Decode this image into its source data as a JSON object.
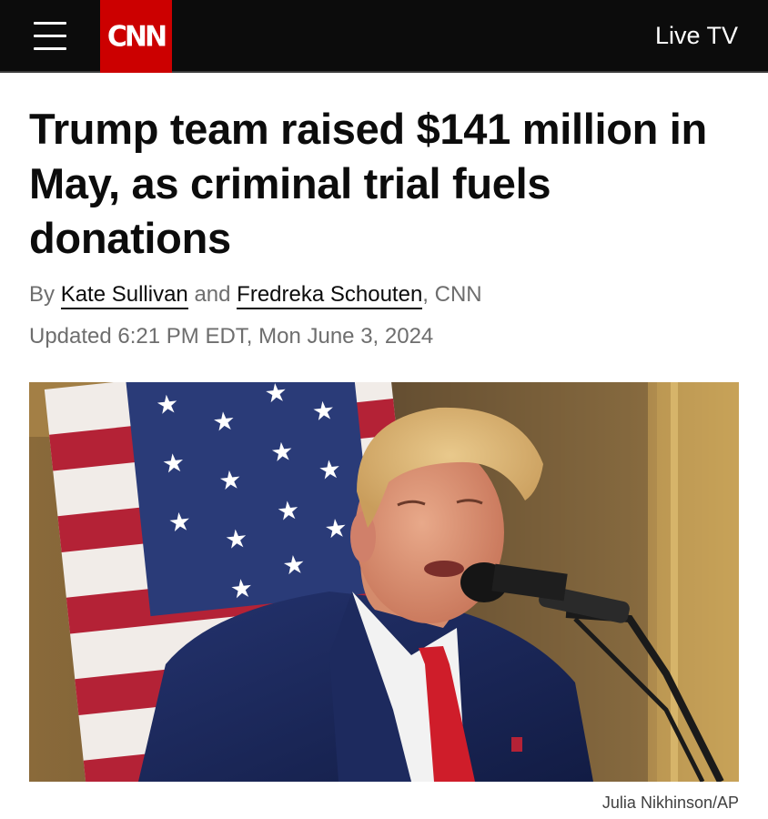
{
  "header": {
    "logo_text": "CNN",
    "live_tv_label": "Live TV",
    "brand_color": "#cc0000"
  },
  "article": {
    "headline": "Trump team raised $141 million in May, as criminal trial fuels donations",
    "byline": {
      "prefix": "By ",
      "author_1": "Kate Sullivan",
      "conjunction": " and ",
      "author_2": "Fredreka Schouten",
      "suffix": ", CNN"
    },
    "updated": "Updated 6:21 PM EDT, Mon June 3, 2024",
    "photo_credit": "Julia Nikhinson/AP"
  }
}
